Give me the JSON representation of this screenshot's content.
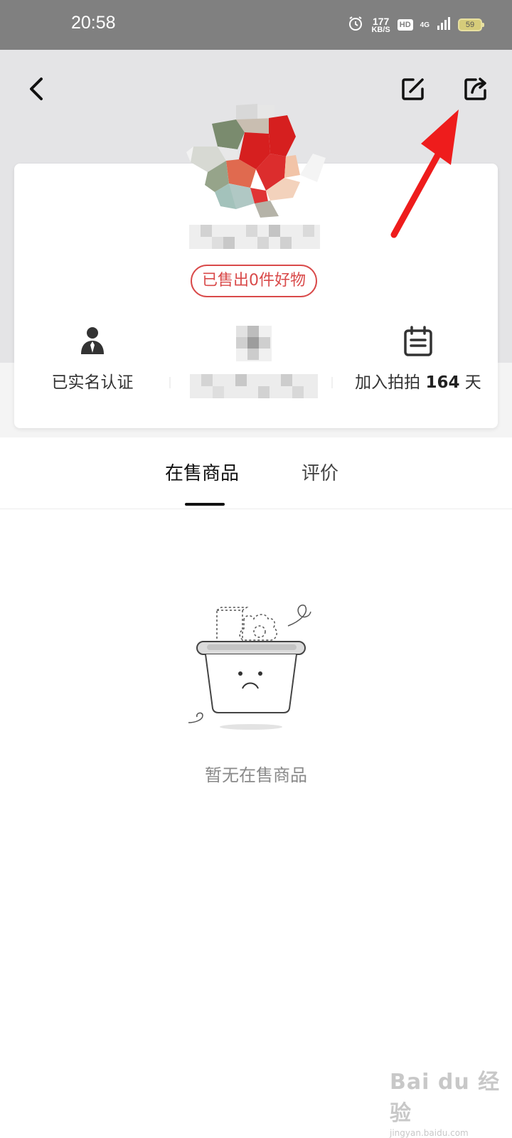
{
  "status_bar": {
    "time": "20:58",
    "net_speed": "177",
    "net_unit": "KB/S",
    "hd": "HD",
    "network": "4G",
    "battery": "59"
  },
  "header": {
    "back_icon": "chevron-left-icon",
    "edit_icon": "edit-icon",
    "share_icon": "share-icon"
  },
  "profile": {
    "sold_badge": "已售出0件好物",
    "stats": {
      "verified_label": "已实名认证",
      "days_prefix": "加入拍拍 ",
      "days_value": "164",
      "days_suffix": " 天"
    }
  },
  "tabs": {
    "on_sale": "在售商品",
    "reviews": "评价"
  },
  "empty_state": {
    "message": "暂无在售商品"
  },
  "watermark": {
    "main": "Bai du 经验",
    "sub": "jingyan.baidu.com"
  },
  "colors": {
    "accent_red": "#d94a4a",
    "header_bg": "#e4e4e6",
    "statusbar_bg": "#808080",
    "annotation_arrow": "#ee1c1c"
  }
}
